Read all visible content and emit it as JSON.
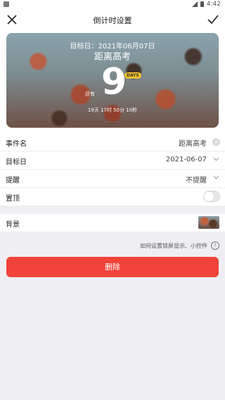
{
  "statusbar": {
    "time": "4:42"
  },
  "topbar": {
    "title": "倒计时设置"
  },
  "card": {
    "target_date": "目标日：2021年06月07日",
    "event_name": "距离高考",
    "prefix": "还有",
    "number": "9",
    "badge": "DAYS",
    "sub": "19天 17时 50分 10秒"
  },
  "form": {
    "rows": [
      {
        "label": "事件名",
        "value": "距离高考"
      },
      {
        "label": "目标日",
        "value": "2021-06-07"
      },
      {
        "label": "提醒",
        "value": "不提醒"
      },
      {
        "label": "置顶"
      }
    ],
    "pin_on": false
  },
  "background": {
    "label": "背景"
  },
  "help": {
    "text": "如何设置锁屏显示、小控件"
  },
  "delete_button": {
    "label": "删除"
  },
  "colors": {
    "accent": "#f0433a",
    "badge": "#f4c12c"
  }
}
